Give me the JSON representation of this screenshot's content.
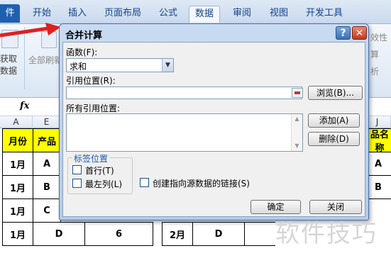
{
  "ribbon": {
    "tabs": [
      {
        "label": "件"
      },
      {
        "label": "开始"
      },
      {
        "label": "插入"
      },
      {
        "label": "页面布局"
      },
      {
        "label": "公式"
      },
      {
        "label": "数据"
      },
      {
        "label": "审阅"
      },
      {
        "label": "视图"
      },
      {
        "label": "开发工具"
      }
    ],
    "active_tab": "数据",
    "left_group": {
      "line1": "获取",
      "line2": "数据"
    },
    "refresh_label": "全部刷新",
    "right_labels": {
      "validity": "效性",
      "calc": "算",
      "analysis": "析"
    }
  },
  "formula_bar": {
    "fx": "fx"
  },
  "sheet": {
    "columns": [
      "A",
      "E",
      "J"
    ],
    "rows": [
      [
        "月份",
        "产品",
        "品名称"
      ],
      [
        "1月",
        "A",
        "A"
      ],
      [
        "1月",
        "B",
        "B"
      ],
      [
        "1月",
        "C",
        ""
      ],
      [
        "1月",
        "D",
        "6",
        "2月",
        "D"
      ]
    ]
  },
  "dialog": {
    "title": "合并计算",
    "help": "?",
    "close": "✕",
    "function_label": "函数(F):",
    "function_value": "求和",
    "ref_label": "引用位置(R):",
    "ref_value": "",
    "browse_label": "浏览(B)...",
    "all_refs_label": "所有引用位置:",
    "add_label": "添加(A)",
    "delete_label": "删除(D)",
    "label_group_title": "标签位置",
    "first_row_label": "首行(T)",
    "left_col_label": "最左列(L)",
    "link_label": "创建指向源数据的链接(S)",
    "ok_label": "确定",
    "cancel_label": "关闭"
  },
  "watermark": "软件技巧",
  "colors": {
    "accent": "#1f5fb0",
    "arrow": "#e02020",
    "header_yellow": "#ffff00"
  }
}
